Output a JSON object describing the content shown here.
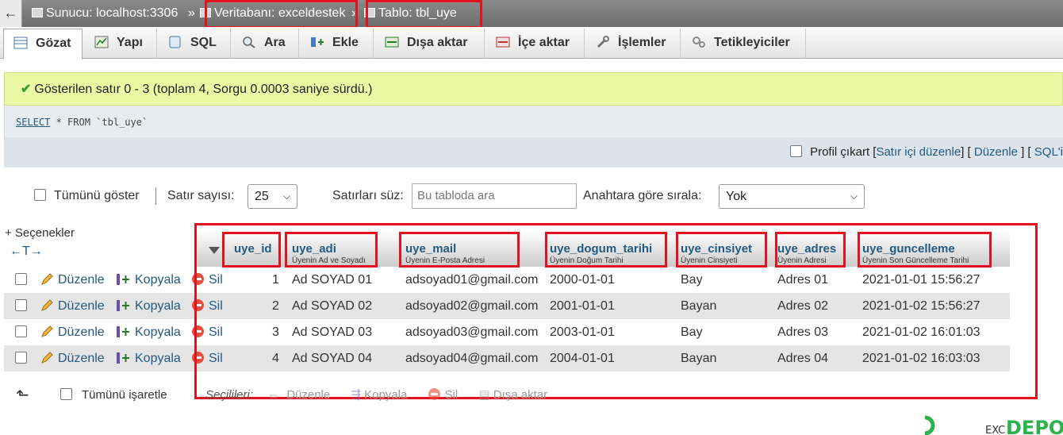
{
  "breadcrumb": {
    "back_glyph": "←",
    "server": "Sunucu: localhost:3306",
    "sep1": "»",
    "database": "Veritabanı: exceldestek",
    "sep2": "»",
    "table": "Tablo: tbl_uye"
  },
  "tabs": [
    {
      "label": "Gözat",
      "icon": "browse-icon",
      "active": true
    },
    {
      "label": "Yapı",
      "icon": "structure-icon"
    },
    {
      "label": "SQL",
      "icon": "sql-icon"
    },
    {
      "label": "Ara",
      "icon": "search-icon"
    },
    {
      "label": "Ekle",
      "icon": "insert-icon"
    },
    {
      "label": "Dışa aktar",
      "icon": "export-icon"
    },
    {
      "label": "İçe aktar",
      "icon": "import-icon"
    },
    {
      "label": "İşlemler",
      "icon": "wrench-icon"
    },
    {
      "label": "Tetikleyiciler",
      "icon": "triggers-icon"
    }
  ],
  "message": "Gösterilen satır 0 - 3 (toplam 4, Sorgu 0.0003 saniye sürdü.)",
  "query": {
    "keyword": "SELECT",
    "rest": " * FROM `tbl_uye`"
  },
  "query_actions": {
    "profile_label": "Profil çıkart",
    "inline_edit": "Satır içi düzenle",
    "edit": "Düzenle",
    "sql_php": "SQL'i",
    "bracket_open": "[",
    "bracket_mid1": "] [",
    "bracket_mid2": "] ["
  },
  "controls": {
    "show_all": "Tümünü göster",
    "row_count_label": "Satır sayısı:",
    "row_count_value": "25",
    "filter_label": "Satırları süz:",
    "filter_placeholder": "Bu tabloda ara",
    "sort_label": "Anahtara göre sırala:",
    "sort_value": "Yok"
  },
  "options_label": "+ Seçenekler",
  "resize_glyph": "←T→",
  "columns": [
    {
      "name": "uye_id",
      "comment": ""
    },
    {
      "name": "uye_adi",
      "comment": "Üyenin Ad ve Soyadı"
    },
    {
      "name": "uye_mail",
      "comment": "Üyenin E-Posta Adresi"
    },
    {
      "name": "uye_dogum_tarihi",
      "comment": "Üyenin Doğum Tarihi"
    },
    {
      "name": "uye_cinsiyet",
      "comment": "Üyenin Cinsiyeti"
    },
    {
      "name": "uye_adres",
      "comment": "Üyenin Adresi"
    },
    {
      "name": "uye_guncelleme",
      "comment": "Üyenin Son Güncelleme Tarihi"
    }
  ],
  "row_actions": {
    "edit": "Düzenle",
    "copy": "Kopyala",
    "delete": "Sil"
  },
  "rows": [
    [
      "1",
      "Ad SOYAD 01",
      "adsoyad01@gmail.com",
      "2000-01-01",
      "Bay",
      "Adres 01",
      "2021-01-01 15:56:27"
    ],
    [
      "2",
      "Ad SOYAD 02",
      "adsoyad02@gmail.com",
      "2001-01-01",
      "Bayan",
      "Adres 02",
      "2021-01-02 15:56:27"
    ],
    [
      "3",
      "Ad SOYAD 03",
      "adsoyad03@gmail.com",
      "2003-01-01",
      "Bay",
      "Adres 03",
      "2021-01-02 16:01:03"
    ],
    [
      "4",
      "Ad SOYAD 04",
      "adsoyad04@gmail.com",
      "2004-01-01",
      "Bayan",
      "Adres 04",
      "2021-01-02 16:03:03"
    ]
  ],
  "footer": {
    "check_all": "Tümünü işaretle",
    "selected_label": "Seçilileri:",
    "edit": "Düzenle",
    "copy": "Kopyala",
    "delete": "Sil",
    "export": "Dışa aktar"
  },
  "colors": {
    "accent": "#235a81",
    "highlight": "#e3121c",
    "message_bg": "#ebf8a4"
  }
}
